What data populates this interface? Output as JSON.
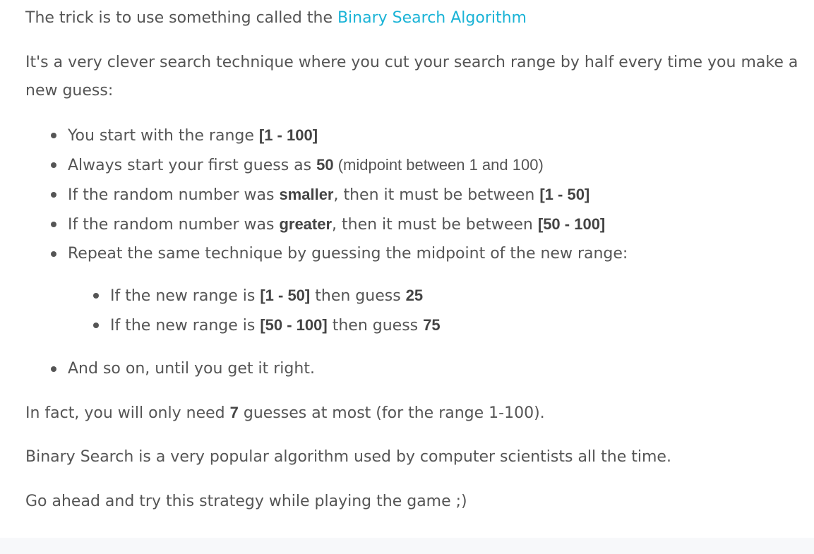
{
  "p1": {
    "text": "The trick is to use something called the ",
    "link": "Binary Search Algorithm"
  },
  "p2": {
    "text": "It's a very clever search technique where you cut your search range by half every time you make a new guess:"
  },
  "list": {
    "item1": {
      "pre": "You start with the range ",
      "bold": "[1 - 100]"
    },
    "item2": {
      "pre": "Always start your first guess as ",
      "bold": "50",
      "post": " (midpoint between 1 and 100)"
    },
    "item3": {
      "pre": "If the random number was ",
      "bold1": "smaller",
      "mid": ", then it must be between ",
      "bold2": "[1 - 50]"
    },
    "item4": {
      "pre": "If the random number was ",
      "bold1": "greater",
      "mid": ", then it must be between ",
      "bold2": "[50 - 100]"
    },
    "item5": {
      "text": "Repeat the same technique by guessing the midpoint of the new range:"
    },
    "sub1": {
      "pre": "If the new range is ",
      "bold1": "[1 - 50]",
      "mid": " then guess ",
      "bold2": "25"
    },
    "sub2": {
      "pre": "If the new range is ",
      "bold1": "[50 - 100]",
      "mid": " then guess ",
      "bold2": "75"
    },
    "item6": {
      "text": "And so on, until you get it right."
    }
  },
  "p3": {
    "pre": "In fact, you will only need ",
    "bold": "7",
    "post": " guesses at most (for the range 1-100)."
  },
  "p4": {
    "text": "Binary Search is a very popular algorithm used by computer scientists all the time."
  },
  "p5": {
    "text": "Go ahead and try this strategy while playing the game ;)"
  },
  "colors": {
    "text": "#555555",
    "link": "#1ab3d6",
    "footer": "#f7f8fa"
  }
}
